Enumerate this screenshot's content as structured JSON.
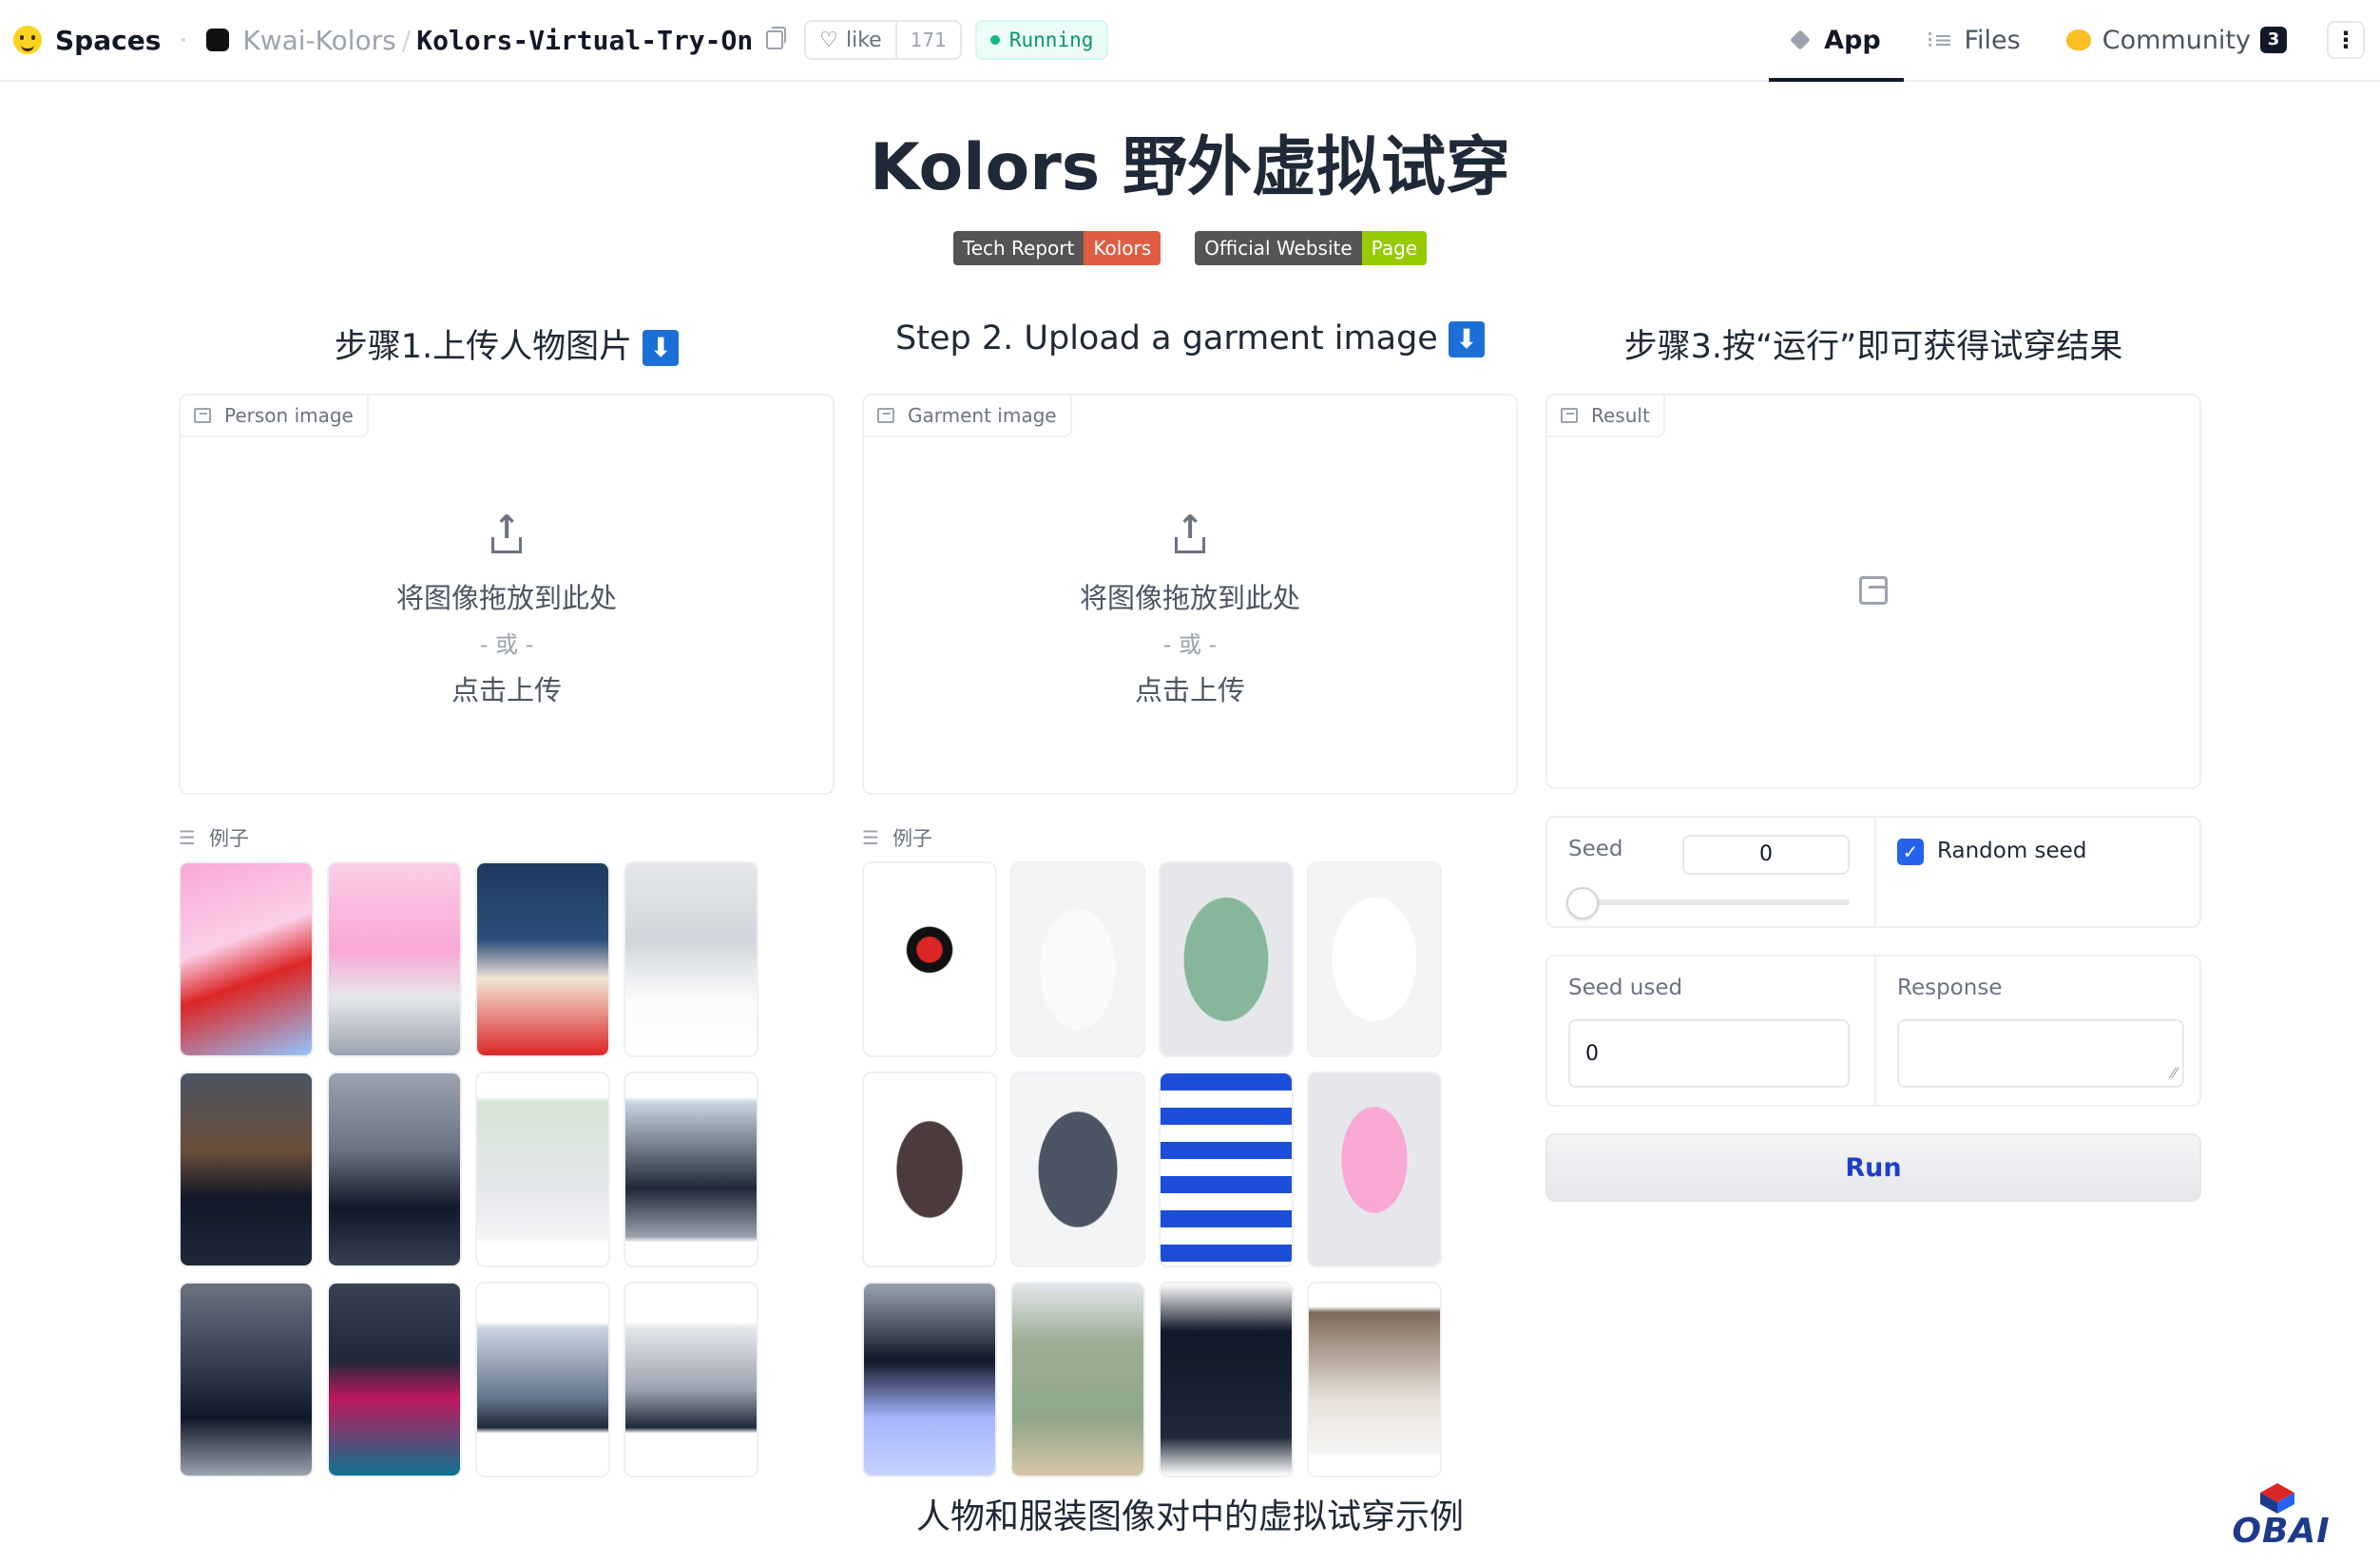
{
  "topbar": {
    "brand": "Spaces",
    "org": "Kwai-Kolors",
    "separator": "/",
    "repo": "Kolors-Virtual-Try-On",
    "like_label": "like",
    "like_count": "171",
    "status": "Running",
    "tabs": [
      {
        "label": "App",
        "icon": "app-icon",
        "active": true
      },
      {
        "label": "Files",
        "icon": "files-icon",
        "active": false
      },
      {
        "label": "Community",
        "icon": "community-icon",
        "active": false,
        "badge": "3"
      }
    ],
    "more_icon": "more-icon"
  },
  "header": {
    "title": "Kolors 野外虚拟试穿",
    "badges": [
      {
        "left": "Tech Report",
        "right": "Kolors",
        "right_color": "#e05d44"
      },
      {
        "left": "Official Website",
        "right": "Page",
        "right_color": "#97ca00"
      }
    ]
  },
  "steps": [
    {
      "title": "步骤1.上传人物图片",
      "arrow": "⬇"
    },
    {
      "title": "Step 2. Upload a garment image",
      "arrow": "⬇"
    },
    {
      "title": "步骤3.按“运行”即可获得试穿结果"
    }
  ],
  "person_panel": {
    "label": "Person image",
    "drop_text": "将图像拖放到此处",
    "or_text": "- 或 -",
    "click_text": "点击上传"
  },
  "garment_panel": {
    "label": "Garment image",
    "drop_text": "将图像拖放到此处",
    "or_text": "- 或 -",
    "click_text": "点击上传"
  },
  "result_panel": {
    "label": "Result"
  },
  "examples": {
    "person_label": "例子",
    "garment_label": "例子",
    "person_thumbs": [
      {
        "name": "person-example-1"
      },
      {
        "name": "person-example-2"
      },
      {
        "name": "person-example-3"
      },
      {
        "name": "person-example-4"
      },
      {
        "name": "person-example-5"
      },
      {
        "name": "person-example-6"
      },
      {
        "name": "person-example-7"
      },
      {
        "name": "person-example-8"
      },
      {
        "name": "person-example-9"
      },
      {
        "name": "person-example-10"
      },
      {
        "name": "person-example-11"
      },
      {
        "name": "person-example-12"
      }
    ],
    "garment_thumbs": [
      {
        "name": "garment-example-1"
      },
      {
        "name": "garment-example-2"
      },
      {
        "name": "garment-example-3"
      },
      {
        "name": "garment-example-4"
      },
      {
        "name": "garment-example-5"
      },
      {
        "name": "garment-example-6"
      },
      {
        "name": "garment-example-7"
      },
      {
        "name": "garment-example-8"
      },
      {
        "name": "garment-example-9"
      },
      {
        "name": "garment-example-10"
      },
      {
        "name": "garment-example-11"
      },
      {
        "name": "garment-example-12"
      }
    ]
  },
  "controls": {
    "seed_label": "Seed",
    "seed_value": "0",
    "random_seed_label": "Random seed",
    "random_seed_checked": true,
    "seed_used_label": "Seed used",
    "seed_used_value": "0",
    "response_label": "Response",
    "response_value": "",
    "run_label": "Run"
  },
  "footer": {
    "caption": "人物和服装图像对中的虚拟试穿示例",
    "watermark": "OBAI"
  },
  "colors": {
    "accent": "#2563eb",
    "run_text": "#1d3fc9",
    "status_green": "#059669"
  }
}
